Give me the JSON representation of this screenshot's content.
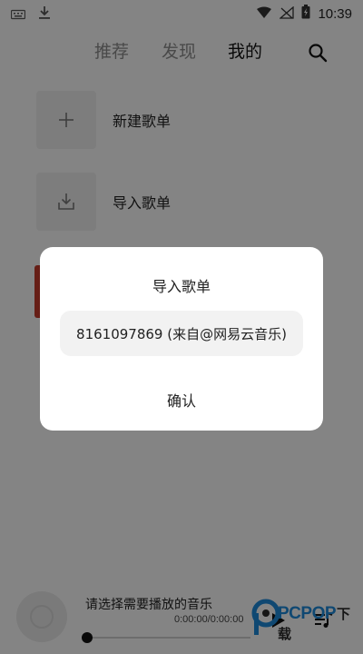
{
  "status_bar": {
    "time": "10:39",
    "left_icons": [
      "keyboard-icon",
      "download-icon"
    ],
    "right_icons": [
      "wifi-icon",
      "no-signal-icon",
      "battery-icon"
    ]
  },
  "tabs": [
    {
      "label": "推荐",
      "active": false
    },
    {
      "label": "发现",
      "active": false
    },
    {
      "label": "我的",
      "active": true
    }
  ],
  "actions": {
    "search_icon": "search-icon",
    "new_playlist": {
      "label": "新建歌单",
      "icon": "plus-icon"
    },
    "import_playlist": {
      "label": "导入歌单",
      "icon": "import-icon"
    }
  },
  "player": {
    "song_prompt": "请选择需要播放的音乐",
    "time": "0:00:00/0:00:00",
    "progress": 0,
    "play_icon": "play-icon",
    "queue_icon": "playlist-icon"
  },
  "watermark": {
    "brand": "PCPOP",
    "suffix": "下载"
  },
  "dialog": {
    "title": "导入歌单",
    "input_value": "8161097869 (来自@网易云音乐)",
    "confirm_label": "确认"
  },
  "colors": {
    "accent_red": "#c0392b",
    "watermark_blue": "#1e88d8",
    "scrim": "rgba(0,0,0,0.47)"
  }
}
